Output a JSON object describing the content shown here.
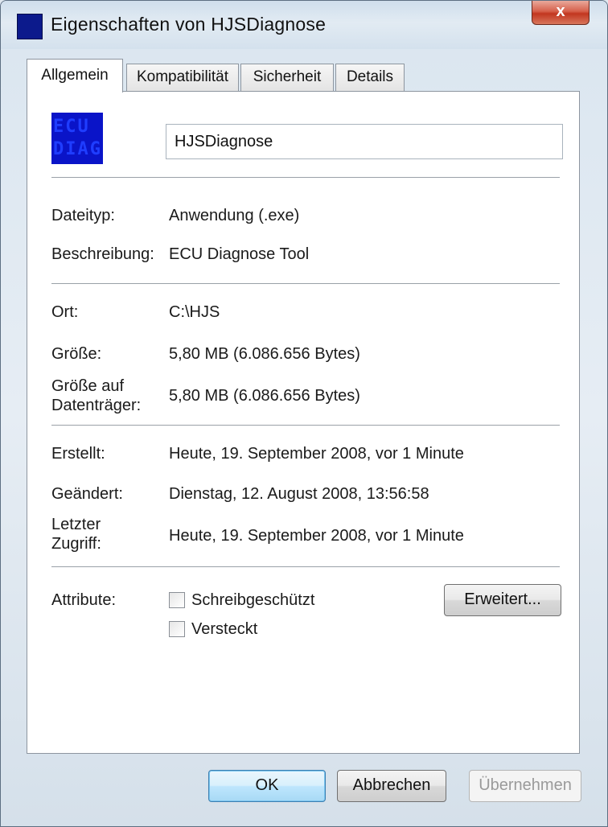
{
  "window": {
    "title": "Eigenschaften von HJSDiagnose",
    "close_label": "x"
  },
  "tabs": [
    {
      "label": "Allgemein",
      "active": true
    },
    {
      "label": "Kompatibilität",
      "active": false
    },
    {
      "label": "Sicherheit",
      "active": false
    },
    {
      "label": "Details",
      "active": false
    }
  ],
  "file": {
    "icon_name": "ecu-diagnose-icon",
    "icon_text": "ECU DIAG",
    "name": "HJSDiagnose"
  },
  "properties": {
    "dateityp": {
      "label": "Dateityp:",
      "value": "Anwendung (.exe)"
    },
    "beschreibung": {
      "label": "Beschreibung:",
      "value": "ECU Diagnose Tool"
    },
    "ort": {
      "label": "Ort:",
      "value": "C:\\HJS"
    },
    "groesse": {
      "label": "Größe:",
      "value": "5,80 MB (6.086.656 Bytes)"
    },
    "groesse_datentraeger": {
      "label": "Größe auf Datenträger:",
      "value": "5,80 MB (6.086.656 Bytes)"
    },
    "erstellt": {
      "label": "Erstellt:",
      "value": "Heute, 19. September 2008, vor 1 Minute"
    },
    "geaendert": {
      "label": "Geändert:",
      "value": "Dienstag, 12. August 2008, 13:56:58"
    },
    "letzter_zugriff": {
      "label": "Letzter Zugriff:",
      "value": "Heute, 19. September 2008, vor 1 Minute"
    }
  },
  "attributes": {
    "label": "Attribute:",
    "schreibgeschuetzt": {
      "label": "Schreibgeschützt",
      "checked": false
    },
    "versteckt": {
      "label": "Versteckt",
      "checked": false
    },
    "erweitert_label": "Erweitert..."
  },
  "buttons": {
    "ok": "OK",
    "abbrechen": "Abbrechen",
    "uebernehmen": "Übernehmen"
  },
  "colors": {
    "accent": "#3c7fb1",
    "icon_bg": "#0a14c8",
    "close_button": "#c2361f"
  }
}
